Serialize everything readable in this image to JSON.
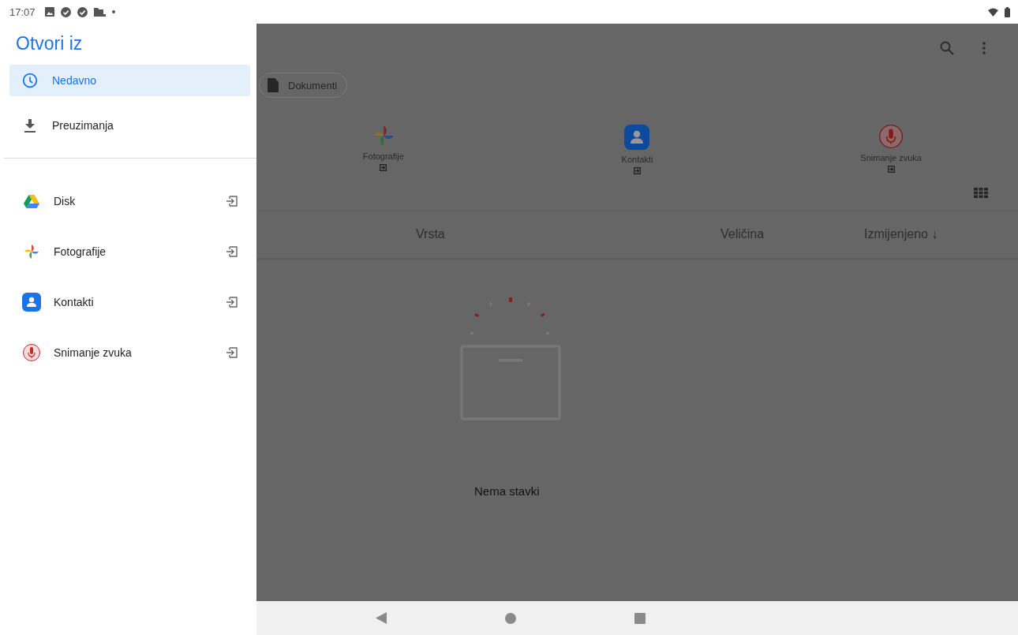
{
  "status_bar": {
    "time": "17:07"
  },
  "drawer": {
    "title": "Otvori iz",
    "sections": [
      [
        {
          "label": "Nedavno",
          "kind": "recent",
          "selected": true,
          "ejectable": false
        },
        {
          "label": "Preuzimanja",
          "kind": "downloads",
          "selected": false,
          "ejectable": false
        }
      ],
      [
        {
          "label": "Disk",
          "kind": "drive",
          "selected": false,
          "ejectable": true
        },
        {
          "label": "Fotografije",
          "kind": "photos",
          "selected": false,
          "ejectable": true
        },
        {
          "label": "Kontakti",
          "kind": "contacts",
          "selected": false,
          "ejectable": true
        },
        {
          "label": "Snimanje zvuka",
          "kind": "recorder",
          "selected": false,
          "ejectable": true
        }
      ]
    ]
  },
  "chips": [
    {
      "label": "Dokumenti"
    }
  ],
  "apps": [
    {
      "label": "Fotografije",
      "kind": "photos"
    },
    {
      "label": "Kontakti",
      "kind": "contacts"
    },
    {
      "label": "Snimanje zvuka",
      "kind": "recorder"
    }
  ],
  "table": {
    "columns": [
      {
        "label": "Vrsta"
      },
      {
        "label": "Veličina"
      },
      {
        "label": "Izmijenjeno ↓"
      }
    ]
  },
  "empty_message": "Nema stavki"
}
